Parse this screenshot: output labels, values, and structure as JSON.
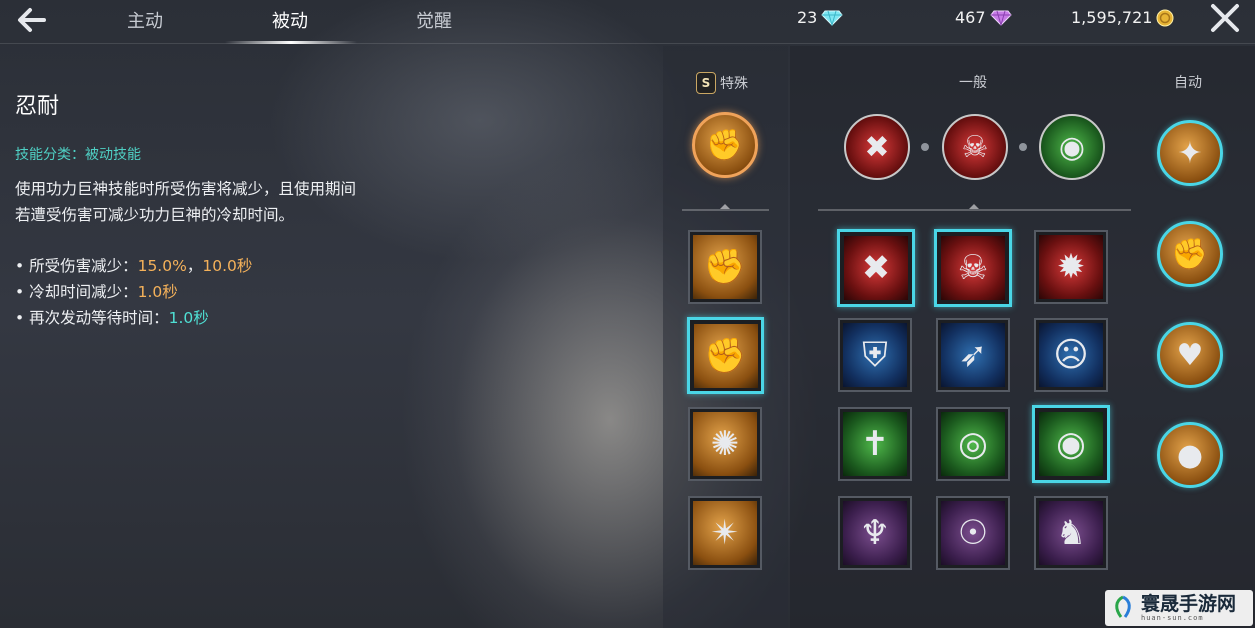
{
  "header": {
    "tabs": [
      {
        "label": "主动"
      },
      {
        "label": "被动"
      },
      {
        "label": "觉醒"
      }
    ],
    "currencies": [
      {
        "value": "23",
        "icon": "diamond-icon"
      },
      {
        "value": "467",
        "icon": "purple-gem-icon"
      },
      {
        "value": "1,595,721",
        "icon": "gold-coin-icon"
      }
    ]
  },
  "skill": {
    "name": "忍耐",
    "category": "技能分类：被动技能",
    "description": "使用功力巨神技能时所受伤害将减少，且使用期间若遭受伤害可减少功力巨神的冷却时间。",
    "effects": [
      {
        "label": "• 所受伤害减少：",
        "value1": "15.0%",
        "sep": "，",
        "value2": "10.0秒"
      },
      {
        "label": "• 冷却时间减少：",
        "value1": "1.0秒"
      },
      {
        "label": "• 再次发动等待时间：",
        "value1": "1.0秒"
      }
    ]
  },
  "columns": {
    "special_badge": "S",
    "special": "特殊",
    "general": "一般",
    "auto": "自动"
  },
  "colors": {
    "accent_cyan": "#4ad6e6",
    "category_text": "#4fd0c4",
    "value_orange": "#f4b15a",
    "value_cyan": "#4fe0d4"
  },
  "watermark": {
    "text": "寰晟手游网",
    "sub": "huan-sun.com"
  }
}
